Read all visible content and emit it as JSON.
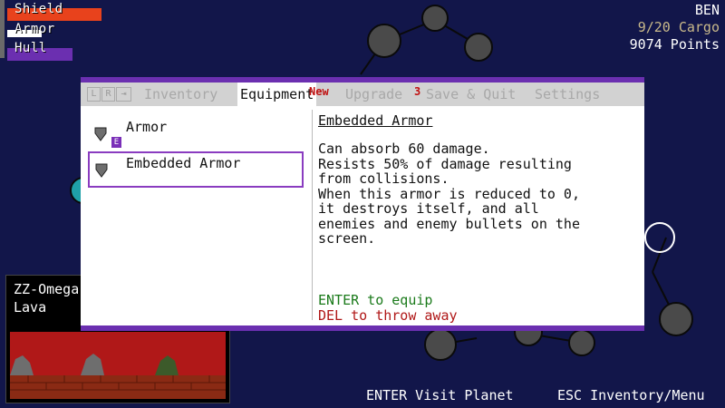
{
  "hud": {
    "stats": [
      {
        "label": "Shield",
        "color": "#e8421c"
      },
      {
        "label": "Armor",
        "color": "#ffffff"
      },
      {
        "label": "Hull",
        "color": "#6b2fb0"
      }
    ],
    "player_name": "BEN",
    "cargo": "9/20 Cargo",
    "points": "9074 Points"
  },
  "planet": {
    "name": "ZZ-Omega",
    "type": "Lava"
  },
  "inventory": {
    "key_hints": [
      "L",
      "R",
      "⇥"
    ],
    "tabs": [
      {
        "label": "Inventory",
        "active": false
      },
      {
        "label": "Equipment",
        "active": true
      },
      {
        "label": "Upgrade",
        "active": false
      },
      {
        "label": "Save & Quit",
        "active": false
      },
      {
        "label": "Settings",
        "active": false
      }
    ],
    "badges": {
      "equipment": "New",
      "upgrade": "3"
    },
    "items": [
      {
        "name": "Armor",
        "equipped_marker": "E",
        "icon": "shield-icon"
      },
      {
        "name": "Embedded Armor",
        "icon": "shield-icon"
      }
    ],
    "detail": {
      "title": "Embedded Armor",
      "lines": [
        "Can absorb 60 damage.",
        "Resists 50% of damage resulting",
        "from collisions.",
        "When this armor is reduced to 0,",
        "it destroys itself, and all",
        "enemies and enemy bullets on the",
        "screen."
      ],
      "equip_action": "ENTER to equip",
      "throw_action": "DEL to throw away"
    }
  },
  "footer": {
    "visit_hint": "ENTER Visit Planet",
    "menu_hint": "ESC Inventory/Menu"
  },
  "colors": {
    "space": "#12164a",
    "accent": "#6b2fb0",
    "equip_green": "#1a7a1a",
    "throw_red": "#b01818"
  }
}
